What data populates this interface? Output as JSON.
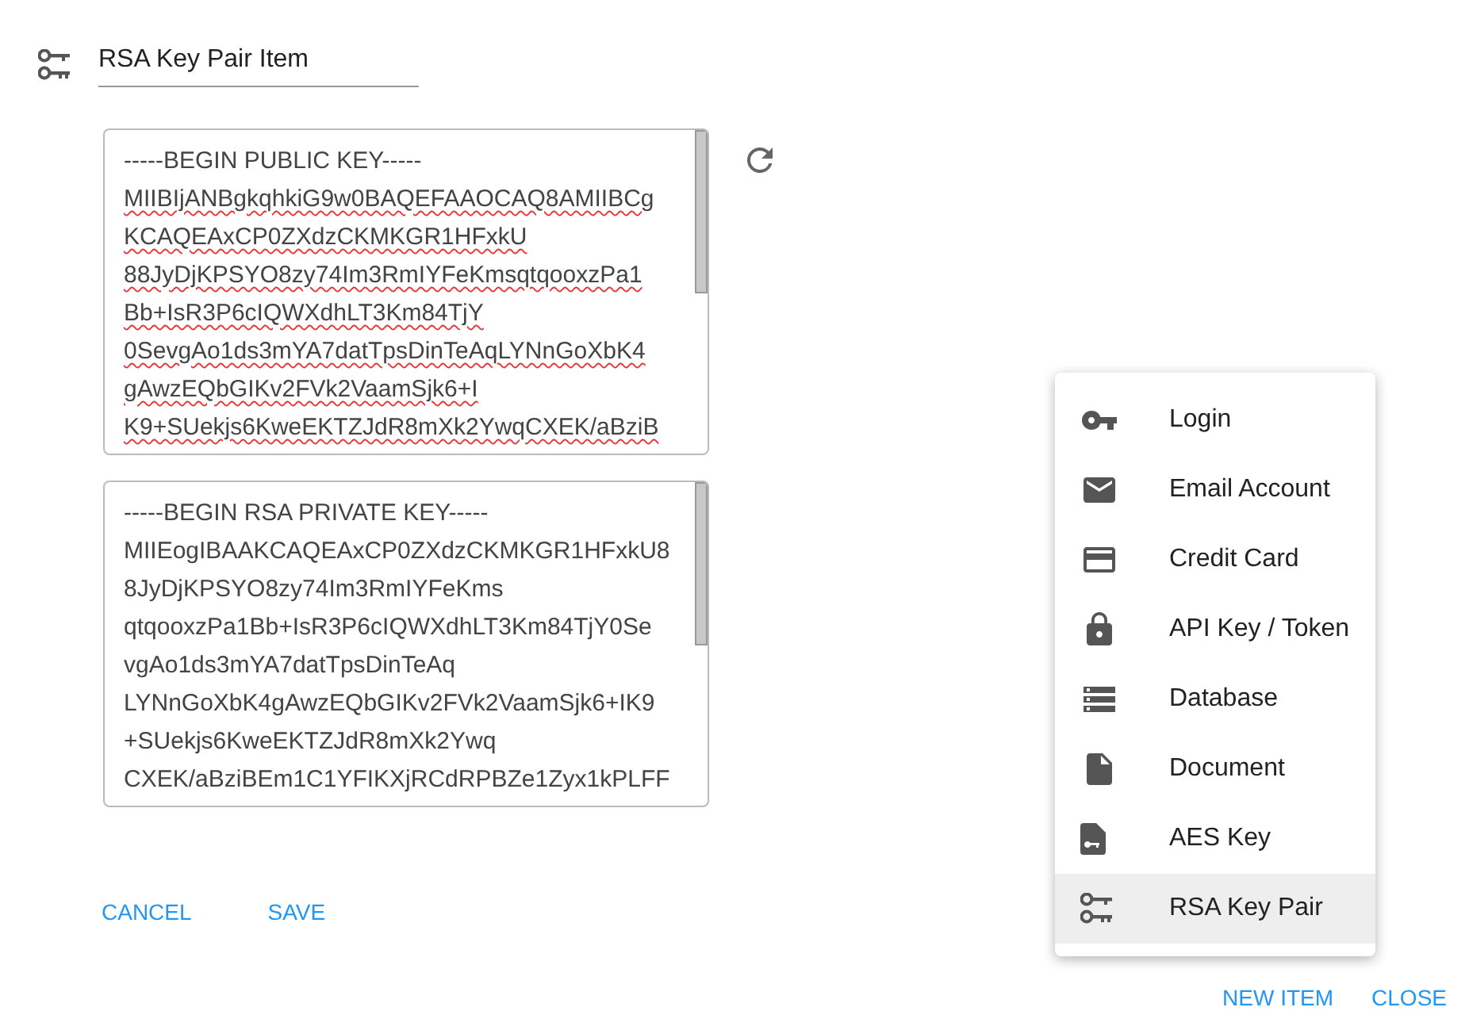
{
  "title_field": {
    "value": "RSA Key Pair Item"
  },
  "public_key": {
    "lines": [
      "-----BEGIN PUBLIC KEY-----",
      "MIIBIjANBgkqhkiG9w0BAQEFAAOCAQ8AMIIBCg",
      "KCAQEAxCP0ZXdzCKMKGR1HFxkU",
      "88JyDjKPSYO8zy74Im3RmIYFeKmsqtqooxzPa1",
      "Bb+IsR3P6cIQWXdhLT3Km84TjY",
      "0SevgAo1ds3mYA7datTpsDinTeAqLYNnGoXbK4",
      "gAwzEQbGIKv2FVk2VaamSjk6+I",
      "K9+SUekjs6KweEKTZJdR8mXk2YwqCXEK/aBziB"
    ],
    "spellcheck_marks": true
  },
  "private_key": {
    "lines": [
      "-----BEGIN RSA PRIVATE KEY-----",
      "MIIEogIBAAKCAQEAxCP0ZXdzCKMKGR1HFxkU8",
      "8JyDjKPSYO8zy74Im3RmIYFeKms",
      "qtqooxzPa1Bb+IsR3P6cIQWXdhLT3Km84TjY0Se",
      "vgAo1ds3mYA7datTpsDinTeAq",
      "LYNnGoXbK4gAwzEQbGIKv2FVk2VaamSjk6+IK9",
      "+SUekjs6KweEKTZJdR8mXk2Ywq",
      "CXEK/aBziBEm1C1YFIKXjRCdRPBZe1Zyx1kPLFF"
    ],
    "spellcheck_marks": false
  },
  "actions": [
    "CANCEL",
    "SAVE"
  ],
  "menu": [
    {
      "kind": "key",
      "label": "Login",
      "selected": false
    },
    {
      "kind": "email",
      "label": "Email Account",
      "selected": false
    },
    {
      "kind": "card",
      "label": "Credit Card",
      "selected": false
    },
    {
      "kind": "lock",
      "label": "API Key / Token",
      "selected": false
    },
    {
      "kind": "database",
      "label": "Database",
      "selected": false
    },
    {
      "kind": "document",
      "label": "Document",
      "selected": false
    },
    {
      "kind": "filekey",
      "label": "AES Key",
      "selected": false
    },
    {
      "kind": "keypair",
      "label": "RSA Key Pair",
      "selected": true
    }
  ],
  "footer_buttons": [
    "NEW ITEM",
    "CLOSE"
  ]
}
